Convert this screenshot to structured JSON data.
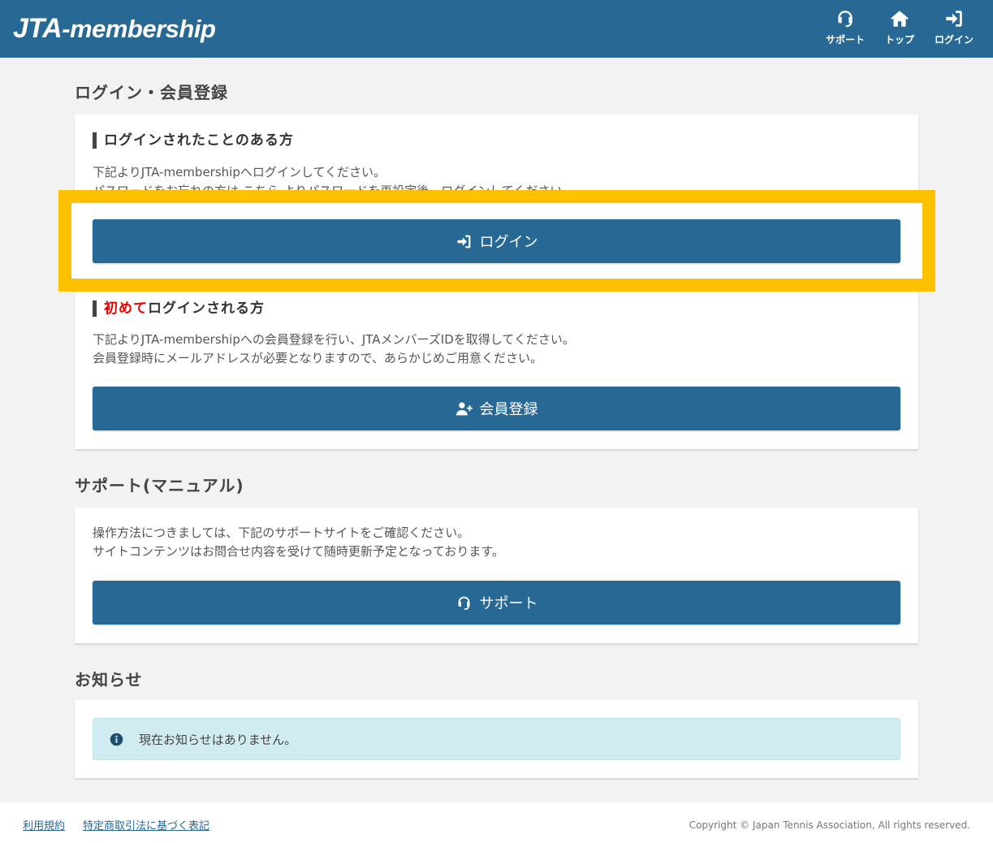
{
  "header": {
    "logo_prefix": "JTA",
    "logo_suffix": "-membership",
    "nav": [
      {
        "label": "サポート",
        "icon": "headset-icon"
      },
      {
        "label": "トップ",
        "icon": "home-icon"
      },
      {
        "label": "ログイン",
        "icon": "sign-in-icon"
      }
    ]
  },
  "login_section": {
    "title": "ログイン・会員登録",
    "existing": {
      "heading": "ログインされたことのある方",
      "desc_line1": "下記よりJTA-membershipへログインしてください。",
      "desc_line2": "パスワードをお忘れの方は こちら よりパスワードを再設定後、ログインしてください。",
      "button_label": "ログイン"
    },
    "new": {
      "heading_red": "初めて",
      "heading_rest": "ログインされる方",
      "desc_line1": "下記よりJTA-membershipへの会員登録を行い、JTAメンバーズIDを取得してください。",
      "desc_line2": "会員登録時にメールアドレスが必要となりますので、あらかじめご用意ください。",
      "button_label": "会員登録"
    }
  },
  "support_section": {
    "title": "サポート(マニュアル)",
    "desc_line1": "操作方法につきましては、下記のサポートサイトをご確認ください。",
    "desc_line2": "サイトコンテンツはお問合せ内容を受けて随時更新予定となっております。",
    "button_label": "サポート"
  },
  "news_section": {
    "title": "お知らせ",
    "message": "現在お知らせはありません。"
  },
  "footer": {
    "link1": "利用規約",
    "link2": "特定商取引法に基づく表記",
    "copyright": "Copyright © Japan Tennis Association, All rights reserved."
  },
  "colors": {
    "primary": "#286895",
    "highlight": "#fdc100",
    "alert_bg": "#d1ecf1",
    "accent_red": "#ee0000"
  }
}
